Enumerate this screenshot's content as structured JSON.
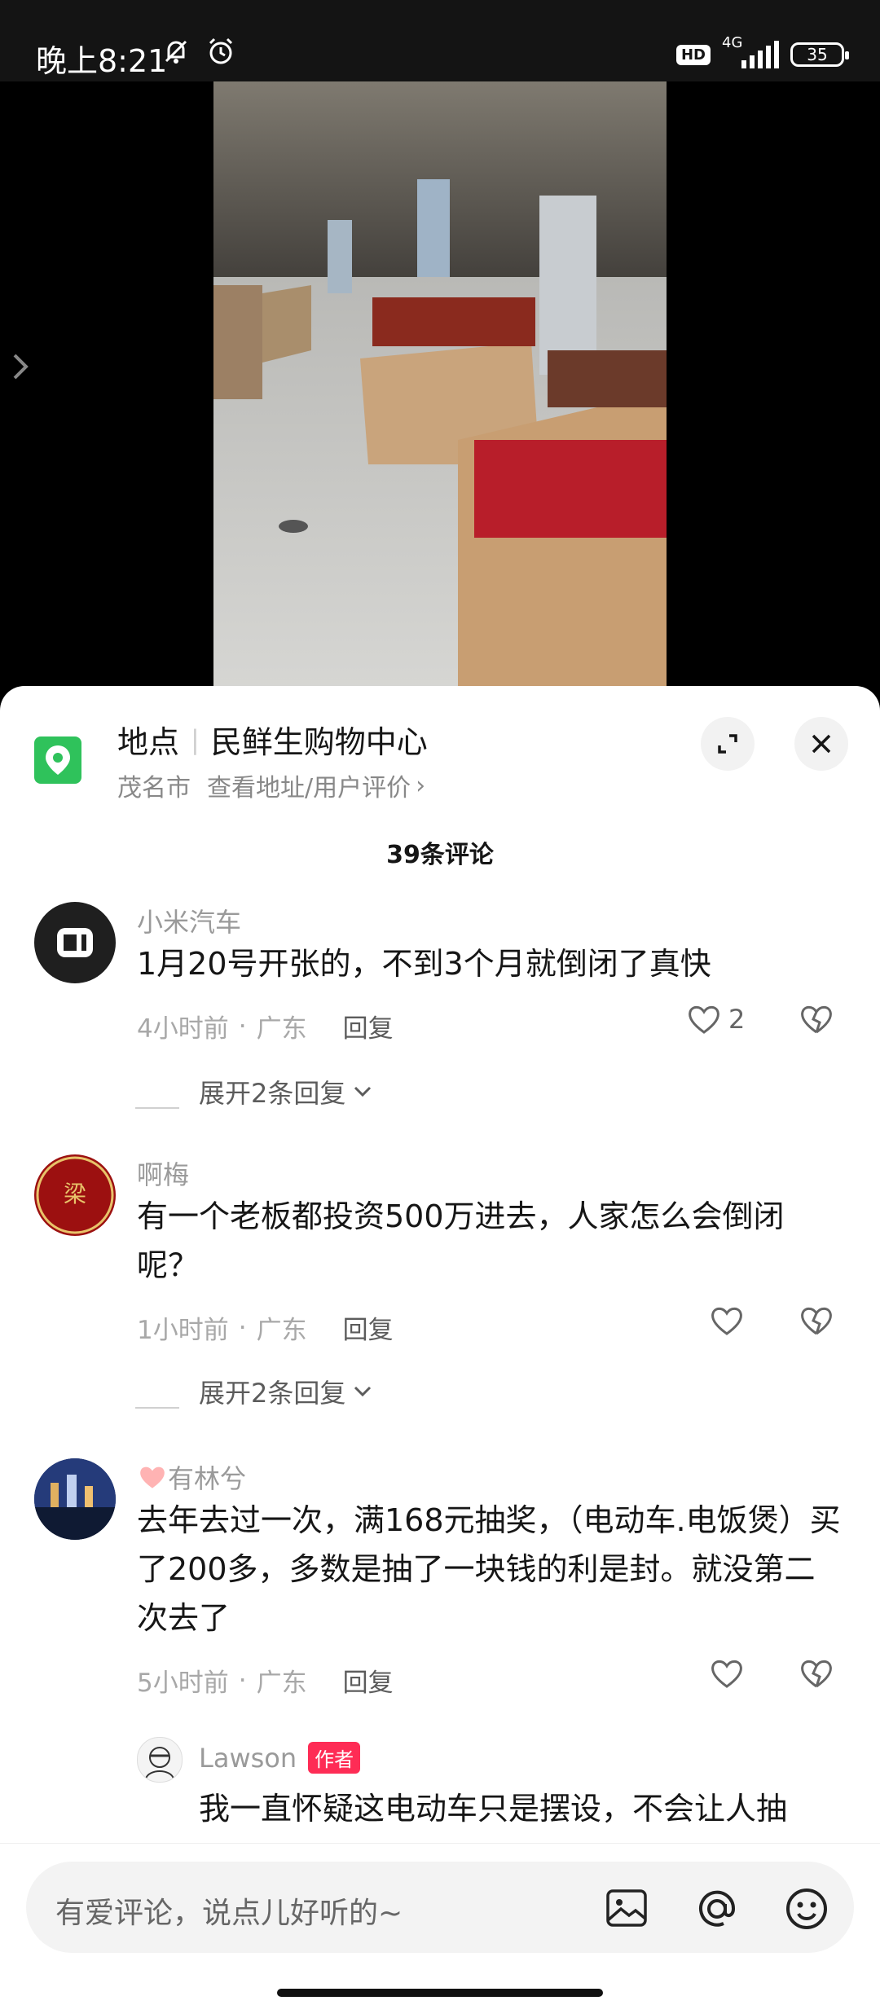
{
  "status": {
    "time": "晚上8:21",
    "hd": "HD",
    "network": "4G",
    "battery": "35"
  },
  "location": {
    "label": "地点",
    "name": "民鲜生购物中心",
    "city": "茂名市",
    "link": "查看地址/用户评价",
    "chevron": "›"
  },
  "comment_count": "39条评论",
  "comments": [
    {
      "user": "小米汽车",
      "text": "1月20号开张的，不到3个月就倒闭了真快",
      "time": "4小时前",
      "region": "广东",
      "reply": "回复",
      "likes": "2",
      "expand": "展开2条回复"
    },
    {
      "user": "啊梅",
      "text": "有一个老板都投资500万进去，人家怎么会倒闭呢？",
      "time": "1小时前",
      "region": "广东",
      "reply": "回复",
      "likes": "",
      "expand": "展开2条回复"
    },
    {
      "user": "有林兮",
      "text": "去年去过一次，满168元抽奖，（电动车.电饭煲）买了200多，多数是抽了一块钱的利是封。就没第二次去了",
      "time": "5小时前",
      "region": "广东",
      "reply": "回复",
      "likes": ""
    }
  ],
  "sub_reply": {
    "user": "Lawson",
    "badge": "作者",
    "text": "我一直怀疑这电动车只是摆设，不会让人抽"
  },
  "input": {
    "placeholder": "有爱评论，说点儿好听的~"
  },
  "meta_sep": "·"
}
